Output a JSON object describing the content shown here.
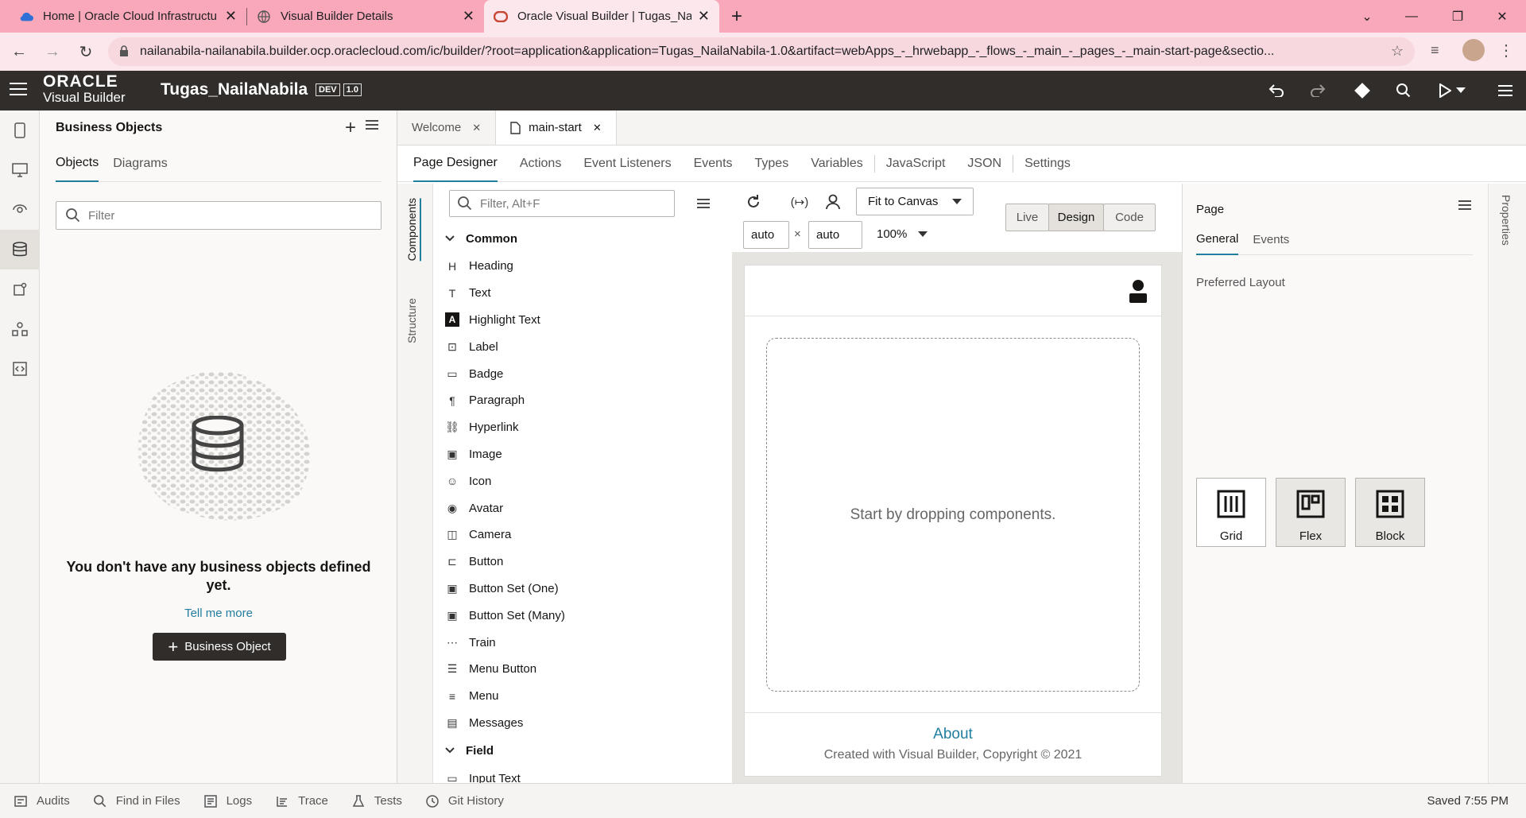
{
  "browser": {
    "tabs": [
      {
        "title": "Home | Oracle Cloud Infrastructu",
        "icon": "cloud-icon"
      },
      {
        "title": "Visual Builder Details",
        "icon": "globe-icon"
      },
      {
        "title": "Oracle Visual Builder | Tugas_Nai",
        "icon": "oracle-icon"
      }
    ],
    "url": "nailanabila-nailanabila.builder.ocp.oraclecloud.com/ic/builder/?root=application&application=Tugas_NailaNabila-1.0&artifact=webApps_-_hrwebapp_-_flows_-_main_-_pages_-_main-start-page&sectio..."
  },
  "header": {
    "brand_top": "ORACLE",
    "brand_bottom": "Visual Builder",
    "app_name": "Tugas_NailaNabila",
    "env_badge": "DEV",
    "version_badge": "1.0"
  },
  "bo_panel": {
    "title": "Business Objects",
    "tabs": [
      "Objects",
      "Diagrams"
    ],
    "filter_placeholder": "Filter",
    "empty_message": "You don't have any business objects defined yet.",
    "link": "Tell me more",
    "button": "Business Object"
  },
  "editor": {
    "file_tabs": [
      "Welcome",
      "main-start"
    ],
    "sub_tabs": [
      "Page Designer",
      "Actions",
      "Event Listeners",
      "Events",
      "Types",
      "Variables",
      "JavaScript",
      "JSON",
      "Settings"
    ],
    "vertical_tabs": [
      "Components",
      "Structure"
    ],
    "palette_filter_placeholder": "Filter, Alt+F",
    "group_common": "Common",
    "components": [
      {
        "label": "Heading",
        "icon": "heading-icon"
      },
      {
        "label": "Text",
        "icon": "text-icon"
      },
      {
        "label": "Highlight Text",
        "icon": "highlight-text-icon"
      },
      {
        "label": "Label",
        "icon": "label-icon"
      },
      {
        "label": "Badge",
        "icon": "badge-icon"
      },
      {
        "label": "Paragraph",
        "icon": "paragraph-icon"
      },
      {
        "label": "Hyperlink",
        "icon": "hyperlink-icon"
      },
      {
        "label": "Image",
        "icon": "image-icon"
      },
      {
        "label": "Icon",
        "icon": "icon-icon"
      },
      {
        "label": "Avatar",
        "icon": "avatar-icon"
      },
      {
        "label": "Camera",
        "icon": "camera-icon"
      },
      {
        "label": "Button",
        "icon": "button-icon"
      },
      {
        "label": "Button Set (One)",
        "icon": "button-set-one-icon"
      },
      {
        "label": "Button Set (Many)",
        "icon": "button-set-many-icon"
      },
      {
        "label": "Train",
        "icon": "train-icon"
      },
      {
        "label": "Menu Button",
        "icon": "menu-button-icon"
      },
      {
        "label": "Menu",
        "icon": "menu-icon"
      },
      {
        "label": "Messages",
        "icon": "messages-icon"
      }
    ],
    "group_field": "Field",
    "group_field_first_item": "Input Text"
  },
  "canvas": {
    "fit": "Fit to Canvas",
    "width": "auto",
    "height": "auto",
    "times": "×",
    "zoom": "100%",
    "modes": [
      "Live",
      "Design",
      "Code"
    ],
    "drop_hint": "Start by dropping components.",
    "footer_link": "About",
    "footer_text": "Created with Visual Builder, Copyright © 2021"
  },
  "properties": {
    "title": "Page",
    "tabs": [
      "General",
      "Events"
    ],
    "section": "Preferred Layout",
    "layouts": [
      "Grid",
      "Flex",
      "Block"
    ],
    "side_tab": "Properties"
  },
  "statusbar": {
    "items": [
      "Audits",
      "Find in Files",
      "Logs",
      "Trace",
      "Tests",
      "Git History"
    ],
    "saved": "Saved 7:55 PM"
  }
}
